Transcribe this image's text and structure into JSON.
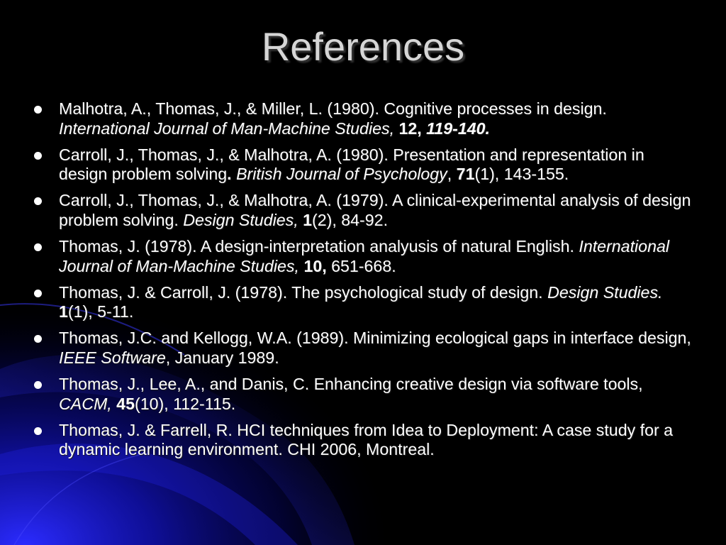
{
  "title": "References",
  "refs": [
    {
      "text": "Malhotra, A., Thomas, J., & Miller, L. (1980). Cognitive processes in design. ",
      "journal": "International Journal of Man-Machine Studies,",
      "vol": " 12,",
      "pages": " 119-140."
    },
    {
      "text": "Carroll, J., Thomas, J., & Malhotra, A. (1980). Presentation and representation in design problem solving",
      "dot": ".",
      "journal": " British Journal of Psychology",
      "sep": ", ",
      "vol": "71",
      "rest": "(1), 143-155."
    },
    {
      "text": "Carroll, J., Thomas, J., & Malhotra, A. (1979). A clinical-experimental analysis of design problem solving. ",
      "journal": "Design Studies,",
      "sep": " ",
      "vol": "1",
      "rest": "(2), 84-92."
    },
    {
      "text": "Thomas, J. (1978). A design-interpretation analyusis of natural English. ",
      "journal": "International Journal of Man-Machine Studies,",
      "sep": " ",
      "vol": "10,",
      "rest": " 651-668."
    },
    {
      "text": "Thomas, J. & Carroll, J. (1978). The psychological study of design. ",
      "journal": "Design Studies.",
      "sep": " ",
      "vol": "1",
      "rest": "(1), 5-11."
    },
    {
      "text": "Thomas, J.C. and Kellogg, W.A. (1989). Minimizing ecological gaps in interface design, ",
      "journal": "IEEE Software",
      "rest": ", January 1989."
    },
    {
      "text": "Thomas, J., Lee, A., and Danis, C. Enhancing creative design via software tools, ",
      "journal": "CACM,",
      "sep": " ",
      "vol": "45",
      "rest": "(10), 112-115."
    },
    {
      "text": "Thomas, J. & Farrell, R. HCI techniques from Idea to Deployment: A case study for a dynamic learning environment. CHI 2006, Montreal."
    }
  ],
  "colors": {
    "background": "#000000",
    "title": "#d6d6d6",
    "text": "#ffffff",
    "accent_blue": "#1a1ad0"
  }
}
